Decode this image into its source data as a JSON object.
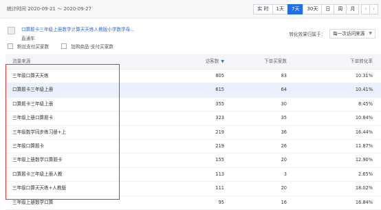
{
  "header": {
    "stat_time": "统计时间 2020-09-21 ～ 2020-09-27",
    "range_buttons": [
      "实 时",
      "1天",
      "7天",
      "30天",
      "日",
      "周",
      "月"
    ],
    "active_range": "7天",
    "prev_icon": "chevron-left-icon",
    "next_icon": "chevron-right-icon"
  },
  "product": {
    "title": "口算题卡三年级上册数学计算天天练人教版小学数学母...",
    "subtitle": "直通车",
    "thumbnail_icon": "product-image-icon"
  },
  "filter": {
    "label": "转化效果归属于：",
    "value": "每一次访问来源"
  },
  "checkboxes": [
    {
      "label": "粉丝支付买家数",
      "checked": false
    },
    {
      "label": "加购商品-支付买家数",
      "checked": false
    }
  ],
  "table": {
    "columns": [
      "流量来源",
      "访客数",
      "下单买家数",
      "下单转化率"
    ],
    "sort_icon": "sort-down-icon",
    "rows": [
      {
        "source": "三年级口算天天练",
        "visitors": "805",
        "buyers": "83",
        "rate": "10.31%"
      },
      {
        "source": "口算题卡三年级上册",
        "visitors": "615",
        "buyers": "64",
        "rate": "10.41%"
      },
      {
        "source": "口算题卡三年级上册",
        "visitors": "355",
        "buyers": "30",
        "rate": "8.45%"
      },
      {
        "source": "三年级上册口算题卡",
        "visitors": "323",
        "buyers": "35",
        "rate": "10.84%"
      },
      {
        "source": "三年级数学同步练习册+上",
        "visitors": "219",
        "buyers": "36",
        "rate": "16.44%"
      },
      {
        "source": "三年级口算题卡",
        "visitors": "219",
        "buyers": "26",
        "rate": "11.87%"
      },
      {
        "source": "三年级上册数学口算题卡",
        "visitors": "155",
        "buyers": "20",
        "rate": "12.90%"
      },
      {
        "source": "口算题卡三年级上册人教",
        "visitors": "113",
        "buyers": "3",
        "rate": "2.65%"
      },
      {
        "source": "三年级口算天天练+人教版",
        "visitors": "111",
        "buyers": "20",
        "rate": "18.02%"
      },
      {
        "source": "三年级上册数学口算",
        "visitors": "95",
        "buyers": "16",
        "rate": "16.84%"
      }
    ]
  },
  "colors": {
    "accent": "#1f6fe8",
    "highlight_row": "#e6f1fd",
    "annotation_box": "#e3342f",
    "link": "#2d6ad6"
  }
}
